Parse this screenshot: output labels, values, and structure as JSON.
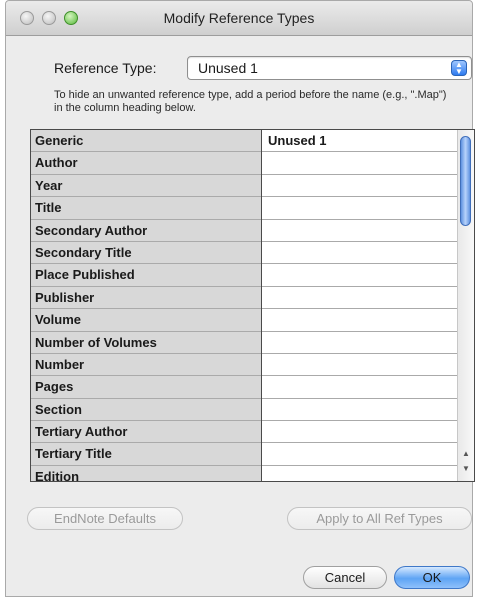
{
  "window": {
    "title": "Modify Reference Types"
  },
  "reference_type": {
    "label": "Reference Type:",
    "selected": "Unused 1"
  },
  "hint": "To hide an unwanted reference type, add a period before the name (e.g., \".Map\") in the column heading below.",
  "fields": [
    {
      "label": "Generic",
      "value": "Unused 1"
    },
    {
      "label": "Author",
      "value": ""
    },
    {
      "label": "Year",
      "value": ""
    },
    {
      "label": "Title",
      "value": ""
    },
    {
      "label": "Secondary Author",
      "value": ""
    },
    {
      "label": "Secondary Title",
      "value": ""
    },
    {
      "label": "Place Published",
      "value": ""
    },
    {
      "label": "Publisher",
      "value": ""
    },
    {
      "label": "Volume",
      "value": ""
    },
    {
      "label": "Number of Volumes",
      "value": ""
    },
    {
      "label": "Number",
      "value": ""
    },
    {
      "label": "Pages",
      "value": ""
    },
    {
      "label": "Section",
      "value": ""
    },
    {
      "label": "Tertiary Author",
      "value": ""
    },
    {
      "label": "Tertiary Title",
      "value": ""
    },
    {
      "label": "Edition",
      "value": ""
    }
  ],
  "buttons": {
    "endnote_defaults": "EndNote Defaults",
    "apply_all": "Apply to All Ref Types",
    "cancel": "Cancel",
    "ok": "OK"
  },
  "icons": {
    "close": "close-icon",
    "minimize": "minimize-icon",
    "zoom": "zoom-icon",
    "select_arrows": "up-down-arrows-icon"
  }
}
